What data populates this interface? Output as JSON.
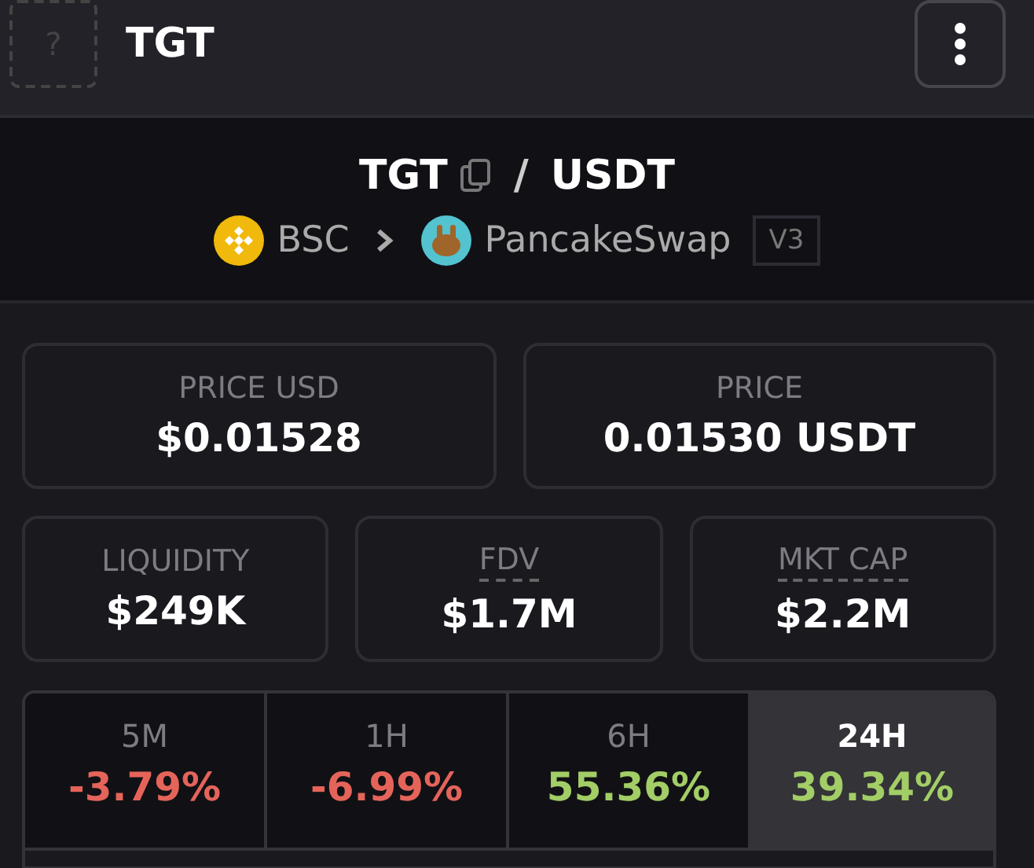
{
  "header": {
    "logo_placeholder": "?",
    "title": "TGT"
  },
  "pair": {
    "base": "TGT",
    "separator": "/",
    "quote": "USDT",
    "chain": "BSC",
    "dex": "PancakeSwap",
    "version": "V3"
  },
  "price_cards": [
    {
      "label": "PRICE USD",
      "value": "$0.01528",
      "hint": false
    },
    {
      "label": "PRICE",
      "value": "0.01530 USDT",
      "hint": false
    }
  ],
  "stat_cards": [
    {
      "label": "LIQUIDITY",
      "value": "$249K",
      "hint": false
    },
    {
      "label": "FDV",
      "value": "$1.7M",
      "hint": true
    },
    {
      "label": "MKT CAP",
      "value": "$2.2M",
      "hint": true
    }
  ],
  "timeframes": [
    {
      "label": "5M",
      "change": "-3.79%",
      "color": "#e5645a",
      "selected": false
    },
    {
      "label": "1H",
      "change": "-6.99%",
      "color": "#e5645a",
      "selected": false
    },
    {
      "label": "6H",
      "change": "55.36%",
      "color": "#a3cd66",
      "selected": false
    },
    {
      "label": "24H",
      "change": "39.34%",
      "color": "#a3cd66",
      "selected": true
    }
  ]
}
